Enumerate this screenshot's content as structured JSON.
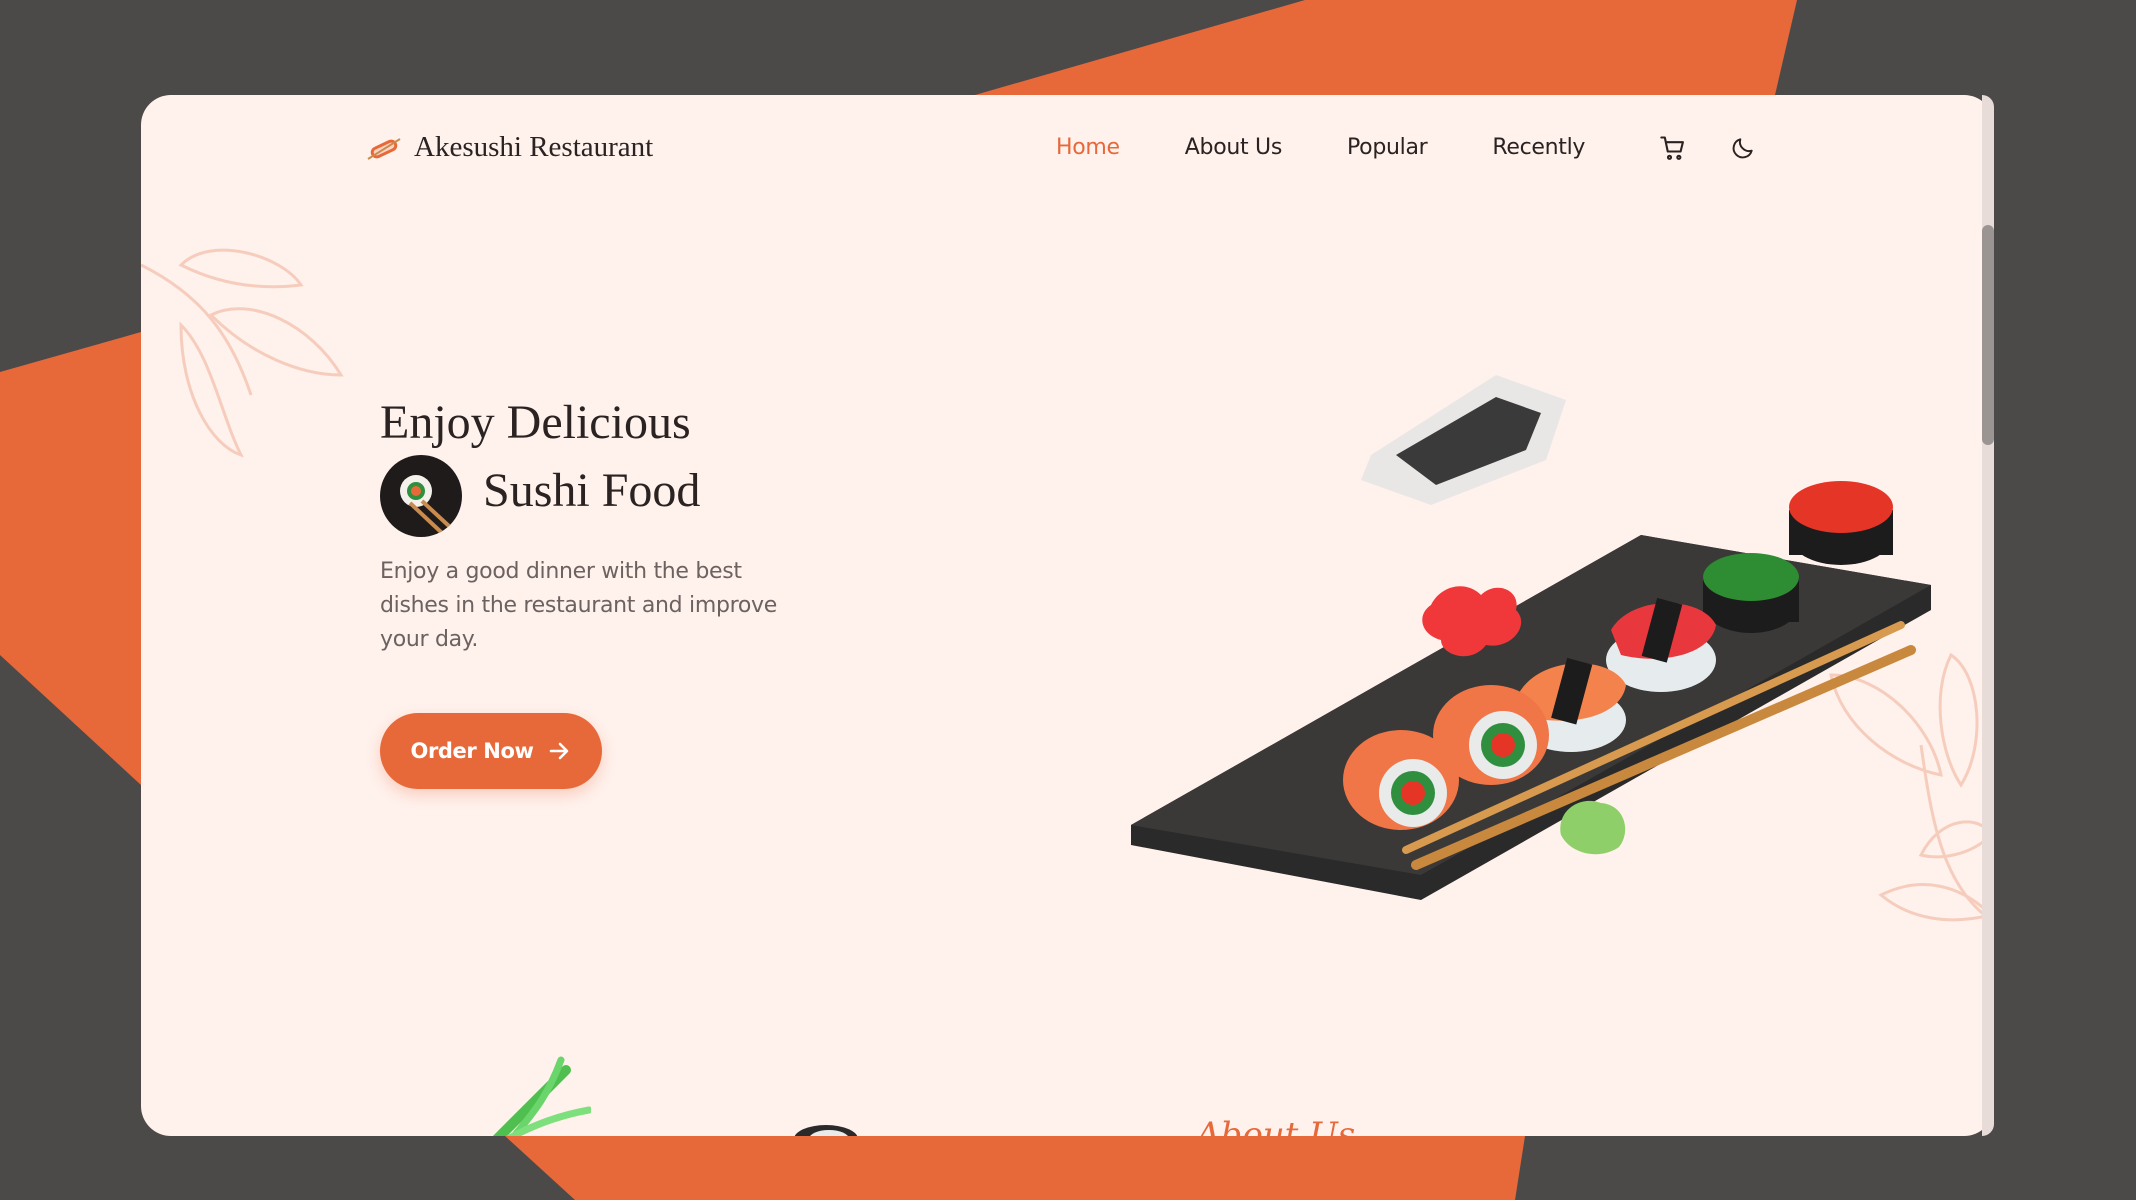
{
  "header": {
    "brand": "Akesushi Restaurant",
    "nav": [
      {
        "label": "Home",
        "active": true
      },
      {
        "label": "About Us",
        "active": false
      },
      {
        "label": "Popular",
        "active": false
      },
      {
        "label": "Recently",
        "active": false
      }
    ],
    "icons": [
      "cart-icon",
      "moon-icon"
    ]
  },
  "hero": {
    "title_line1": "Enjoy Delicious",
    "title_line2": "Sushi Food",
    "description": "Enjoy a good dinner with the best dishes in the restaurant and improve your day.",
    "cta_label": "Order Now",
    "cta_icon": "arrow-right-icon"
  },
  "next_section_peek": "About Us",
  "colors": {
    "accent": "#e7693a",
    "background": "#4c4a49",
    "card": "#fff1ec",
    "text_dark": "#2a2322",
    "text_muted": "#6c6260"
  }
}
